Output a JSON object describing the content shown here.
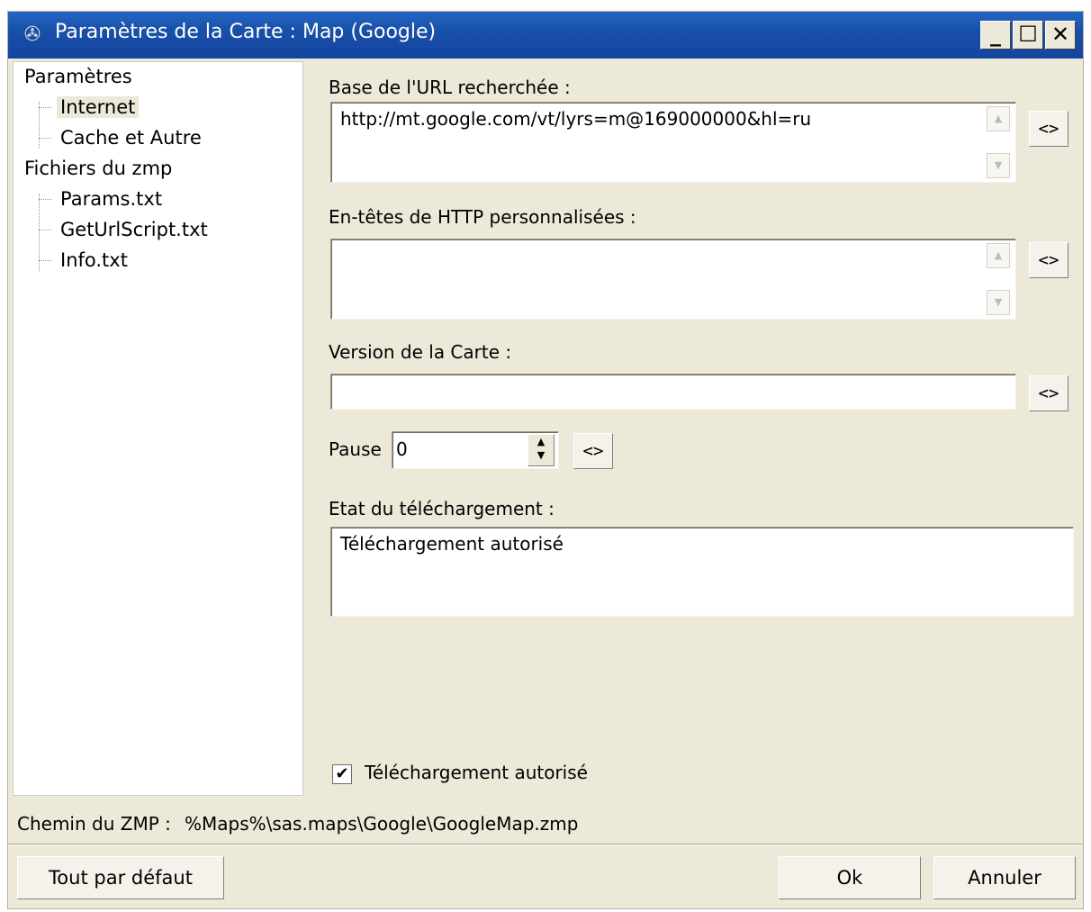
{
  "window": {
    "title": "Paramètres de la Carte : Map (Google)",
    "controls": {
      "minimize": "_",
      "maximize": "☐",
      "close": "✕"
    }
  },
  "tree": {
    "items": [
      {
        "label": "Paramètres"
      },
      {
        "label": "Internet",
        "selected": true
      },
      {
        "label": "Cache et Autre"
      },
      {
        "label": "Fichiers du zmp"
      },
      {
        "label": "Params.txt"
      },
      {
        "label": "GetUrlScript.txt"
      },
      {
        "label": "Info.txt"
      }
    ]
  },
  "form": {
    "url_label": "Base de l'URL recherchée :",
    "url_value": "http://mt.google.com/vt/lyrs=m@169000000&hl=ru",
    "headers_label": "En-têtes de HTTP personnalisées :",
    "headers_value": "",
    "version_label": "Version de la Carte :",
    "version_value": "",
    "pause_label": "Pause",
    "pause_value": "0",
    "state_label": "Etat du téléchargement :",
    "state_value": "Téléchargement autorisé",
    "reset_label": "<>",
    "checkbox_label": "Téléchargement autorisé",
    "checkbox_checked": true
  },
  "footer": {
    "path_label": "Chemin du ZMP :",
    "path_value": "%Maps%\\sas.maps\\Google\\GoogleMap.zmp",
    "defaults_button": "Tout par défaut",
    "ok_button": "Ok",
    "cancel_button": "Annuler"
  }
}
